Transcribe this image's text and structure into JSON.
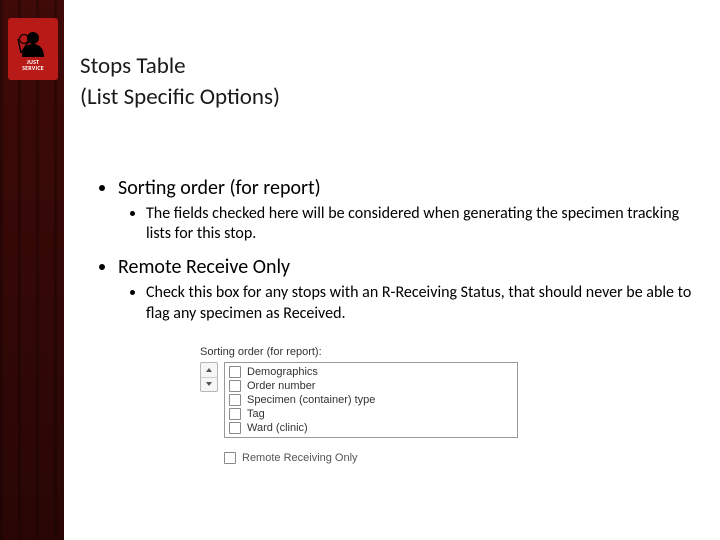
{
  "header": {
    "title_line1": "Stops Table",
    "title_line2": "(List Specific Options)"
  },
  "logo": {
    "line1": "JUST",
    "line2": "SERVICE"
  },
  "bullets": {
    "b1": {
      "heading": "Sorting order (for report)",
      "sub": "The fields checked here will be considered when generating the specimen tracking lists for this stop."
    },
    "b2": {
      "heading": "Remote Receive Only",
      "sub": "Check this box for any stops with an R-Receiving Status, that should never be able to flag any specimen as Received."
    }
  },
  "panel": {
    "group_label": "Sorting order (for report):",
    "items": [
      {
        "label": "Demographics",
        "checked": false
      },
      {
        "label": "Order number",
        "checked": false
      },
      {
        "label": "Specimen (container) type",
        "checked": false
      },
      {
        "label": "Tag",
        "checked": false
      },
      {
        "label": "Ward (clinic)",
        "checked": false
      }
    ],
    "remote_label": "Remote Receiving Only",
    "remote_checked": false
  }
}
